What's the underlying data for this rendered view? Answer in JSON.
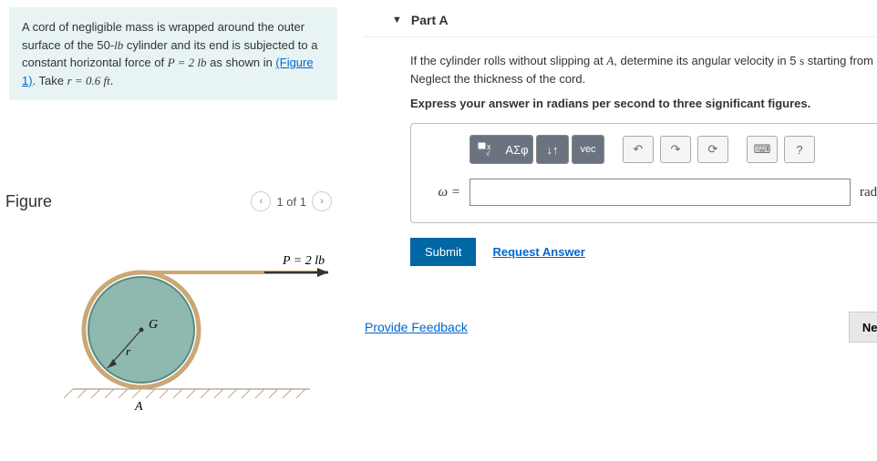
{
  "problem": {
    "text_parts": [
      "A cord of negligible mass is wrapped around the outer surface of the 50-",
      " cylinder and its end is subjected to a constant horizontal force of ",
      " as shown in ",
      ". Take ",
      "."
    ],
    "lb": "lb",
    "P_eq": "P = 2 lb",
    "fig_link": "(Figure 1)",
    "r_eq": "r = 0.6 ft"
  },
  "figure": {
    "title": "Figure",
    "pager": "1 of 1",
    "P_label": "P = 2 lb",
    "G_label": "G",
    "r_label": "r",
    "A_label": "A"
  },
  "partA": {
    "title": "Part A",
    "question": "If the cylinder rolls without slipping at A, determine its angular velocity in 5 s starting from rest. Neglect the thickness of the cord.",
    "instruction": "Express your answer in radians per second to three significant figures.",
    "symbols_label": "ΑΣφ",
    "vec_label": "vec",
    "answer_label": "ω =",
    "answer_value": "",
    "unit": "rad/s",
    "submit": "Submit",
    "request": "Request Answer"
  },
  "footer": {
    "feedback": "Provide Feedback",
    "next": "Next"
  }
}
